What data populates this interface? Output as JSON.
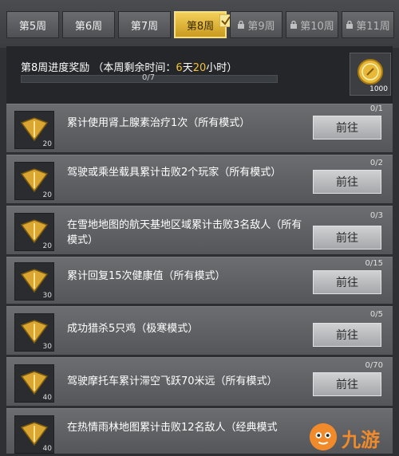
{
  "tabs": [
    {
      "label": "第5周",
      "state": "normal"
    },
    {
      "label": "第6周",
      "state": "normal"
    },
    {
      "label": "第7周",
      "state": "normal"
    },
    {
      "label": "第8周",
      "state": "active"
    },
    {
      "label": "第9周",
      "state": "locked"
    },
    {
      "label": "第10周",
      "state": "locked"
    },
    {
      "label": "第11周",
      "state": "locked"
    }
  ],
  "header": {
    "title_prefix": "第8周进度奖励 （本周剩余时间：",
    "days": "6",
    "days_unit": "天",
    "hours": "20",
    "hours_unit": "小时）",
    "progress_text": "0/7",
    "progress_fraction": 0,
    "reward_count": "1000"
  },
  "tasks": [
    {
      "text": "累计使用肾上腺素治疗1次（所有模式）",
      "count": "0/1",
      "level": "20",
      "button": "前往"
    },
    {
      "text": "驾驶或乘坐载具累计击败2个玩家（所有模式）",
      "count": "0/2",
      "level": "20",
      "button": "前往"
    },
    {
      "text": "在雪地地图的航天基地区域累计击败3名敌人（所有模式）",
      "count": "0/3",
      "level": "20",
      "button": "前往"
    },
    {
      "text": "累计回复15次健康值（所有模式）",
      "count": "0/15",
      "level": "30",
      "button": "前往"
    },
    {
      "text": "成功猎杀5只鸡（极寒模式）",
      "count": "0/5",
      "level": "30",
      "button": "前往"
    },
    {
      "text": "驾驶摩托车累计滞空飞跃70米远（所有模式）",
      "count": "0/70",
      "level": "40",
      "button": "前往"
    },
    {
      "text": "在热情雨林地图累计击败12名敌人（经典模式",
      "count": "",
      "level": "40",
      "button": ""
    }
  ],
  "watermark": {
    "text": "九游"
  },
  "colors": {
    "accent_gold": "#f1c232",
    "active_tab": "#e6b93a",
    "watermark": "#f08a2a"
  }
}
